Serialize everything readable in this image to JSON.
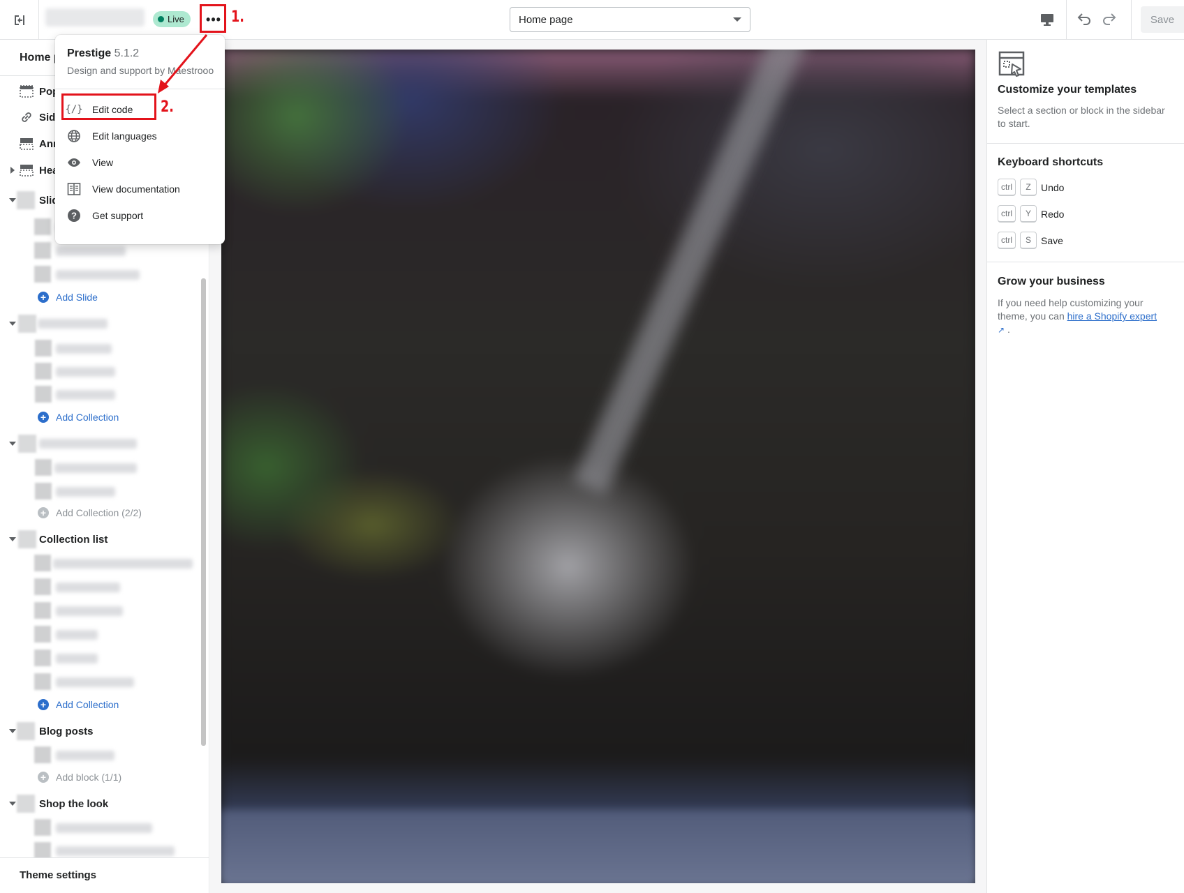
{
  "topbar": {
    "status_badge": "Live",
    "page_select_value": "Home page",
    "save_label": "Save"
  },
  "annotations": {
    "step1": "1.",
    "step2": "2."
  },
  "popover": {
    "theme_name": "Prestige",
    "theme_version": "5.1.2",
    "subtitle": "Design and support by Maestrooo",
    "items": [
      {
        "label": "Edit code",
        "icon": "code-icon"
      },
      {
        "label": "Edit languages",
        "icon": "globe-icon"
      },
      {
        "label": "View",
        "icon": "eye-icon"
      },
      {
        "label": "View documentation",
        "icon": "book-icon"
      },
      {
        "label": "Get support",
        "icon": "question-icon"
      }
    ]
  },
  "sidebar": {
    "title": "Home page",
    "sections_top": [
      {
        "label": "Pop",
        "icon": "popup-section-icon"
      },
      {
        "label": "Side",
        "icon": "link-icon"
      },
      {
        "label": "Ann",
        "icon": "announcement-bar-icon"
      },
      {
        "label": "Hea",
        "icon": "header-icon"
      },
      {
        "label": "Slid"
      }
    ],
    "add_slide": "Add Slide",
    "add_collection_1": "Add Collection",
    "add_collection_2": "Add Collection (2/2)",
    "collection_list": "Collection list",
    "add_collection_3": "Add Collection",
    "blog_posts": "Blog posts",
    "add_block": "Add block (1/1)",
    "shop_the_look": "Shop the look",
    "theme_settings": "Theme settings"
  },
  "right_panel": {
    "customize_title": "Customize your templates",
    "customize_text": "Select a section or block in the sidebar to start.",
    "shortcuts_title": "Keyboard shortcuts",
    "shortcuts": [
      {
        "mod": "ctrl",
        "key": "Z",
        "action": "Undo"
      },
      {
        "mod": "ctrl",
        "key": "Y",
        "action": "Redo"
      },
      {
        "mod": "ctrl",
        "key": "S",
        "action": "Save"
      }
    ],
    "grow_title": "Grow your business",
    "grow_text_before": "If you need help customizing your theme, you can",
    "grow_link": "hire a Shopify expert",
    "grow_text_after": "."
  },
  "colors": {
    "accent": "#2c6ecb",
    "annotation": "#e3131b",
    "live_badge": "#aee9d1"
  }
}
